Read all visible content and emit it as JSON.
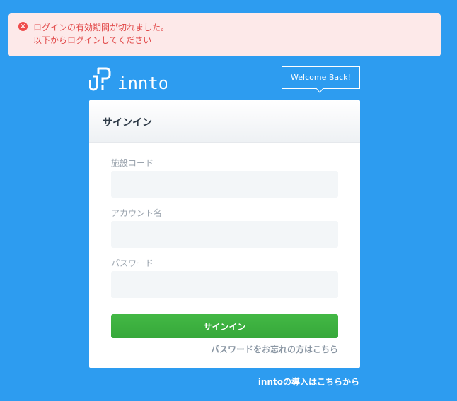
{
  "alert": {
    "icon": "error-circle-icon",
    "line1": "ログインの有効期間が切れました。",
    "line2": "以下からログインしてください",
    "color": "#e14848",
    "background": "#fde9e9"
  },
  "logo": {
    "text": "innto"
  },
  "welcome": {
    "label": "Welcome Back!"
  },
  "card": {
    "title": "サインイン",
    "fields": [
      {
        "label": "施設コード",
        "value": ""
      },
      {
        "label": "アカウント名",
        "value": ""
      },
      {
        "label": "パスワード",
        "value": ""
      }
    ],
    "signin_button": "サインイン",
    "forgot_link": "パスワードをお忘れの方はこちら"
  },
  "footer": {
    "intro_link": "inntoの導入はこちらから"
  },
  "colors": {
    "background": "#2d9cf0",
    "primary_button": "#3aae3d"
  }
}
